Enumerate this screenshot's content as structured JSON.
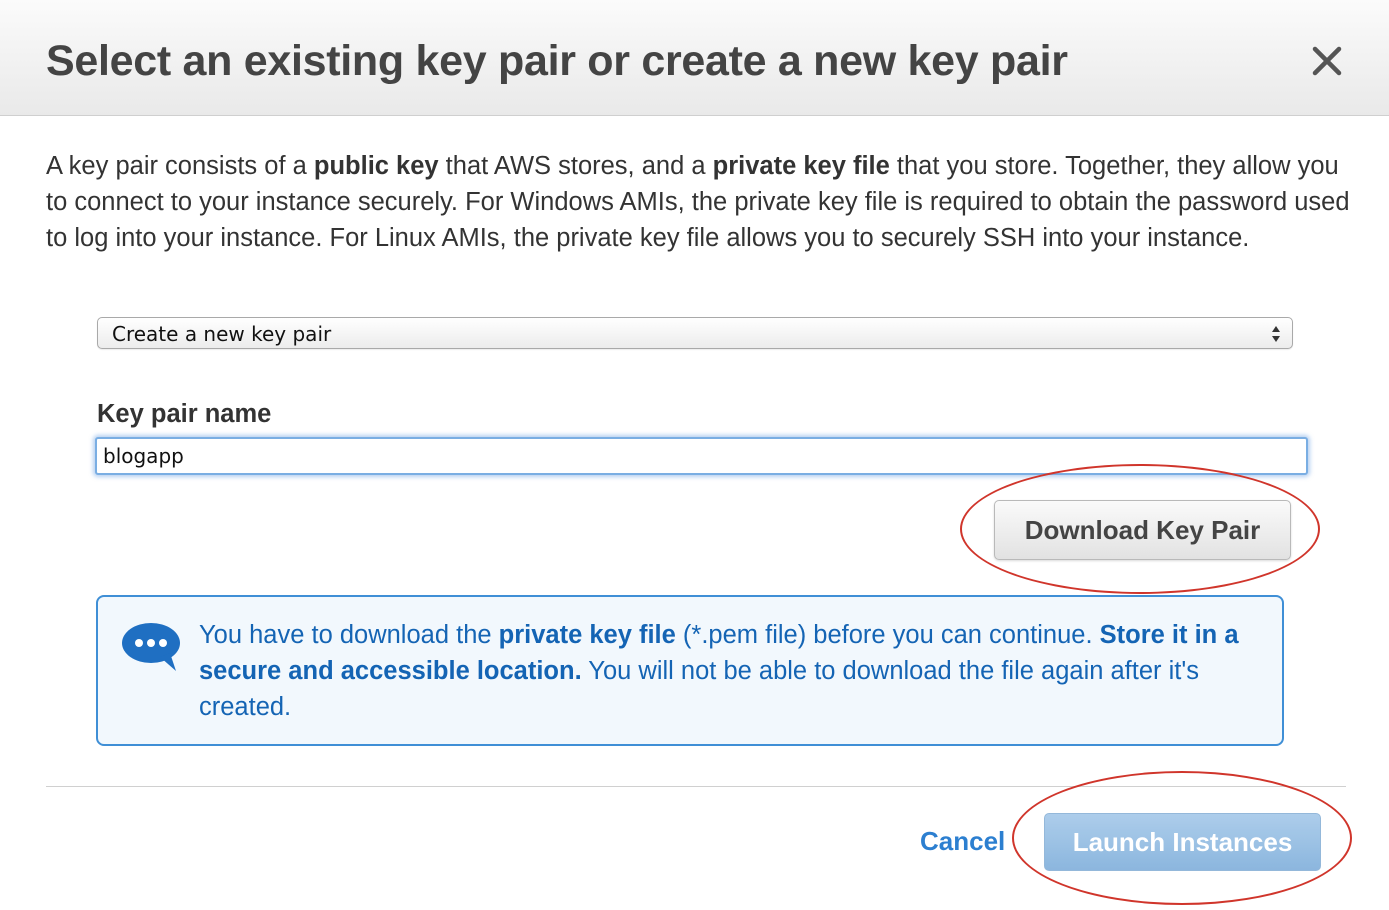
{
  "dialog": {
    "title": "Select an existing key pair or create a new key pair",
    "intro": {
      "part1": "A key pair consists of a ",
      "bold1": "public key",
      "part2": " that AWS stores, and a ",
      "bold2": "private key file",
      "part3": " that you store. Together, they allow you to connect to your instance securely. For Windows AMIs, the private key file is required to obtain the password used to log into your instance. For Linux AMIs, the private key file allows you to securely SSH into your instance."
    },
    "key_pair_select": {
      "selected": "Create a new key pair"
    },
    "key_pair_name": {
      "label": "Key pair name",
      "value": "blogapp"
    },
    "download_button": "Download Key Pair",
    "info": {
      "part1": "You have to download the ",
      "bold1": "private key file",
      "part2": " (*.pem file) before you can continue. ",
      "bold2": "Store it in a secure and accessible location.",
      "part3": " You will not be able to download the file again after it's created."
    },
    "footer": {
      "cancel": "Cancel",
      "launch": "Launch Instances"
    }
  },
  "icons": {
    "close": "close-icon",
    "chat": "chat-bubble-icon",
    "select_arrows": "updown-arrows-icon"
  },
  "colors": {
    "info_text": "#1464b4",
    "info_border": "#3f8fd6",
    "link": "#2c7fd0",
    "launch_button": "#99c0e4",
    "annotation": "#d0352b"
  }
}
